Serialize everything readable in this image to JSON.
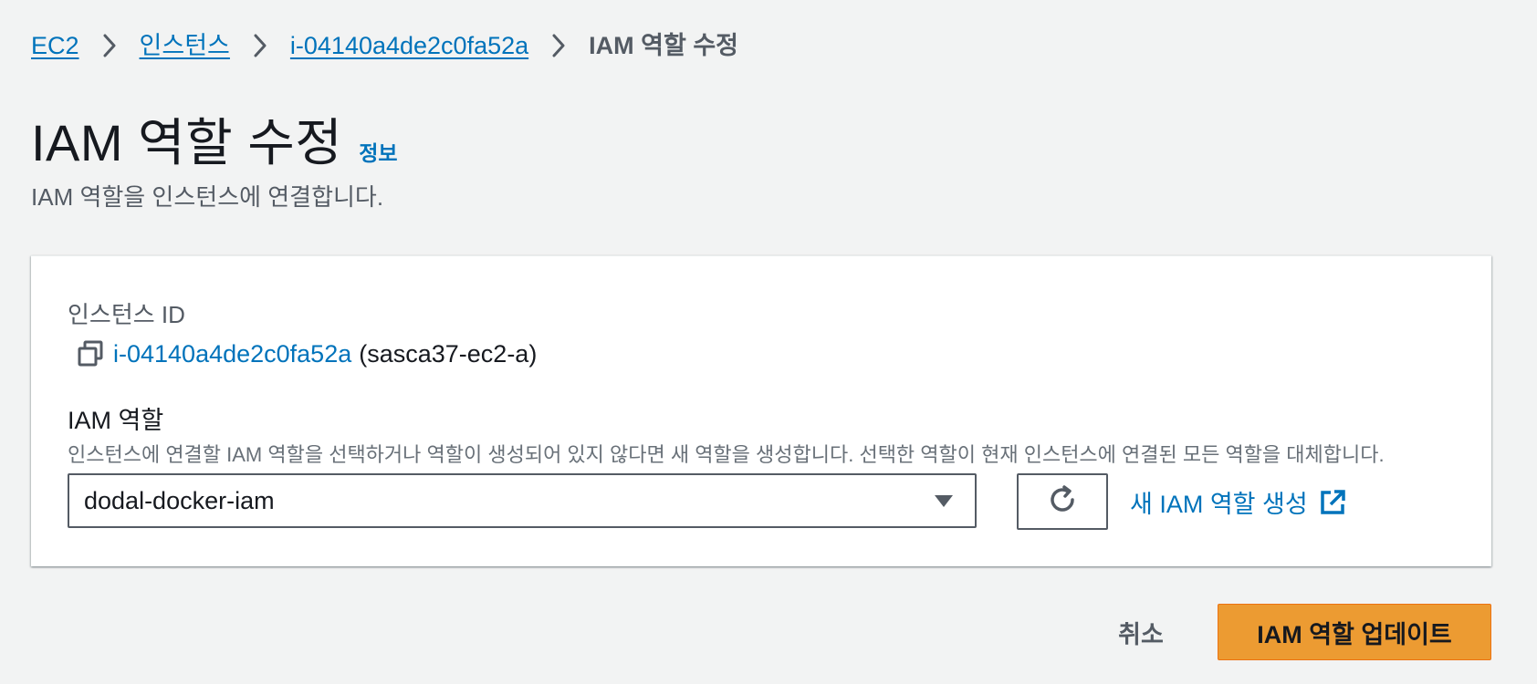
{
  "breadcrumb": {
    "items": [
      {
        "label": "EC2",
        "link": true
      },
      {
        "label": "인스턴스",
        "link": true
      },
      {
        "label": "i-04140a4de2c0fa52a",
        "link": true
      },
      {
        "label": "IAM 역할 수정",
        "link": false
      }
    ],
    "separator_icon": "chevron-right-icon"
  },
  "header": {
    "title": "IAM 역할 수정",
    "info_link": "정보",
    "description": "IAM 역할을 인스턴스에 연결합니다."
  },
  "form": {
    "instance_id_label": "인스턴스 ID",
    "instance_id": "i-04140a4de2c0fa52a",
    "instance_name": "(sasca37-ec2-a)",
    "copy_icon": "copy-icon",
    "iam_role_label": "IAM 역할",
    "iam_role_description": "인스턴스에 연결할 IAM 역할을 선택하거나 역할이 생성되어 있지 않다면 새 역할을 생성합니다. 선택한 역할이 현재 인스턴스에 연결된 모든 역할을 대체합니다.",
    "iam_role_selected": "dodal-docker-iam",
    "refresh_icon": "refresh-icon",
    "create_role_link": "새 IAM 역할 생성",
    "external_icon": "external-link-icon"
  },
  "actions": {
    "cancel_label": "취소",
    "submit_label": "IAM 역할 업데이트"
  },
  "colors": {
    "link": "#0073bb",
    "primary_button": "#ec9b32",
    "background": "#f2f3f3",
    "text": "#16191f",
    "secondary_text": "#545b64"
  }
}
